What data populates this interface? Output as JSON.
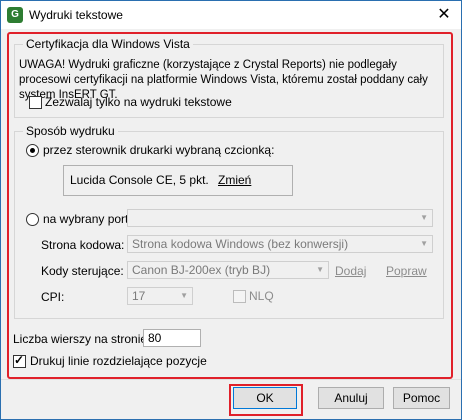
{
  "window": {
    "title": "Wydruki tekstowe",
    "icon": "app-icon",
    "close": "✕"
  },
  "vista": {
    "legend": "Certyfikacja dla Windows Vista",
    "warning": "UWAGA! Wydruki graficzne (korzystające z Crystal Reports) nie podlegały procesowi certyfikacji na platformie Windows Vista, któremu został poddany cały system InsERT GT.",
    "allow_only_text_label": "Zezwalaj tylko na wydruki tekstowe",
    "allow_only_text_checked": false
  },
  "print_method": {
    "legend": "Sposób wydruku",
    "driver_option_label": "przez sterownik drukarki wybraną czcionką:",
    "driver_option_selected": true,
    "font_name": "Lucida Console CE, 5 pkt.",
    "change_font_link": "Zmień",
    "port_option_label": "na wybrany port:",
    "port_option_selected": false,
    "port_value": "",
    "codepage_label": "Strona kodowa:",
    "codepage_value": "Strona kodowa Windows (bez konwersji)",
    "control_codes_label": "Kody sterujące:",
    "control_codes_value": "Canon BJ-200ex (tryb BJ)",
    "add_link": "Dodaj",
    "edit_link": "Popraw",
    "cpi_label": "CPI:",
    "cpi_value": "17",
    "nlq_label": "NLQ",
    "nlq_checked": false
  },
  "lines_per_page_label": "Liczba wierszy na stronie:",
  "lines_per_page_value": "80",
  "print_separator_label": "Drukuj linie rozdzielające pozycje",
  "print_separator_checked": true,
  "buttons": {
    "ok": "OK",
    "cancel": "Anuluj",
    "help": "Pomoc"
  },
  "colors": {
    "highlight": "#e0202a",
    "accent": "#0078d7"
  }
}
